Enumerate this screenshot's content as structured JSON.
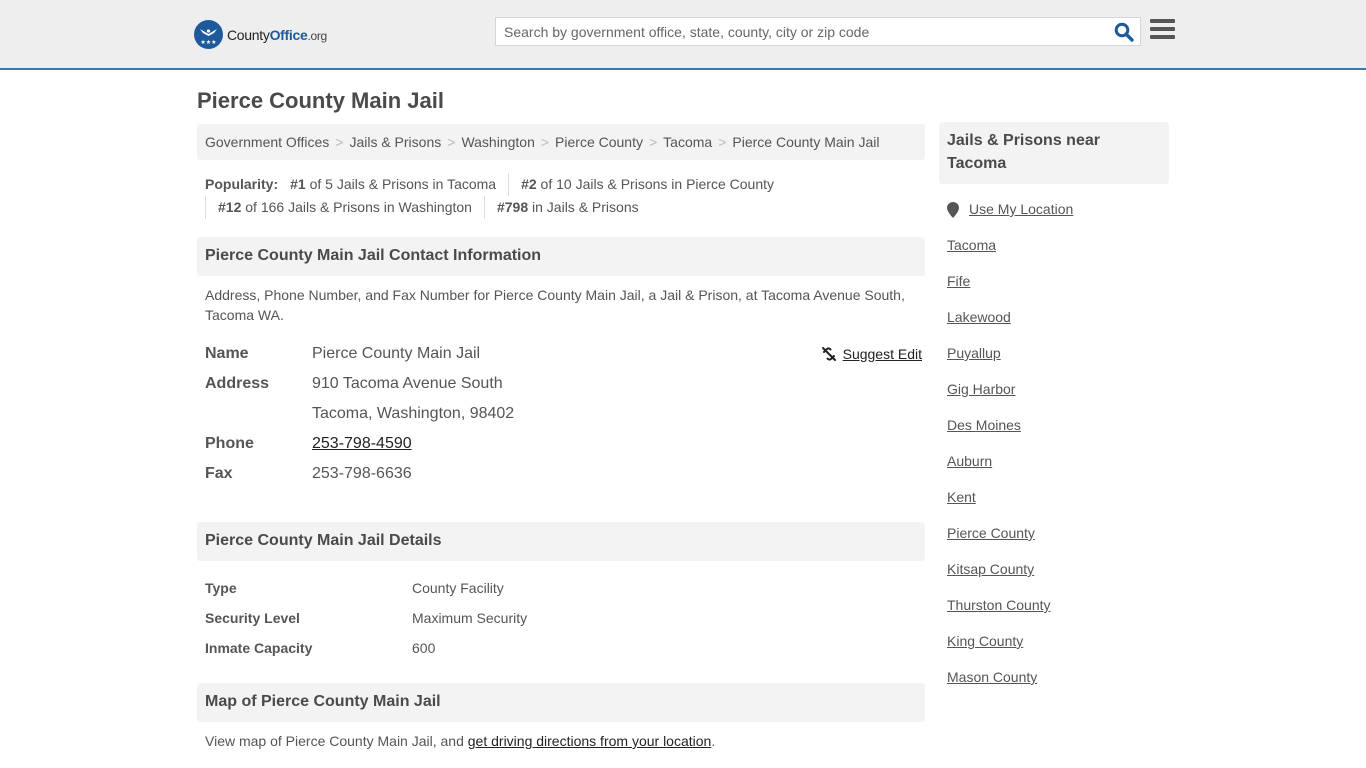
{
  "header": {
    "logo": {
      "part1": "County",
      "part2": "Office",
      "part3": ".org"
    },
    "search_placeholder": "Search by government office, state, county, city or zip code",
    "search_value": ""
  },
  "page_title": "Pierce County Main Jail",
  "breadcrumb": [
    "Government Offices",
    "Jails & Prisons",
    "Washington",
    "Pierce County",
    "Tacoma",
    "Pierce County Main Jail"
  ],
  "breadcrumb_sep": ">",
  "popularity": {
    "label": "Popularity:",
    "items": [
      {
        "rank": "#1",
        "text": " of 5 Jails & Prisons in Tacoma"
      },
      {
        "rank": "#2",
        "text": " of 10 Jails & Prisons in Pierce County"
      },
      {
        "rank": "#12",
        "text": " of 166 Jails & Prisons in Washington"
      },
      {
        "rank": "#798",
        "text": " in Jails & Prisons"
      }
    ]
  },
  "contact": {
    "heading": "Pierce County Main Jail Contact Information",
    "description": "Address, Phone Number, and Fax Number for Pierce County Main Jail, a Jail & Prison, at Tacoma Avenue South, Tacoma WA.",
    "suggest_edit": "Suggest Edit",
    "name_label": "Name",
    "name": "Pierce County Main Jail",
    "address_label": "Address",
    "address_line1": "910 Tacoma Avenue South",
    "address_line2": "Tacoma, Washington, 98402",
    "phone_label": "Phone",
    "phone": "253-798-4590",
    "fax_label": "Fax",
    "fax": "253-798-6636"
  },
  "details": {
    "heading": "Pierce County Main Jail Details",
    "rows": [
      {
        "label": "Type",
        "value": "County Facility"
      },
      {
        "label": "Security Level",
        "value": "Maximum Security"
      },
      {
        "label": "Inmate Capacity",
        "value": "600"
      }
    ]
  },
  "map": {
    "heading": "Map of Pierce County Main Jail",
    "text_before": "View map of Pierce County Main Jail, and ",
    "link": "get driving directions from your location",
    "text_after": "."
  },
  "sidebar": {
    "heading": "Jails & Prisons near Tacoma",
    "use_location": "Use My Location",
    "links": [
      "Tacoma",
      "Fife",
      "Lakewood",
      "Puyallup",
      "Gig Harbor",
      "Des Moines",
      "Auburn",
      "Kent",
      "Pierce County",
      "Kitsap County",
      "Thurston County",
      "King County",
      "Mason County"
    ]
  },
  "colors": {
    "accent": "#337ab7",
    "logo_blue": "#1c5a9c",
    "panel_bg": "#f3f3f3",
    "topbar_bg": "#eeeeee"
  }
}
